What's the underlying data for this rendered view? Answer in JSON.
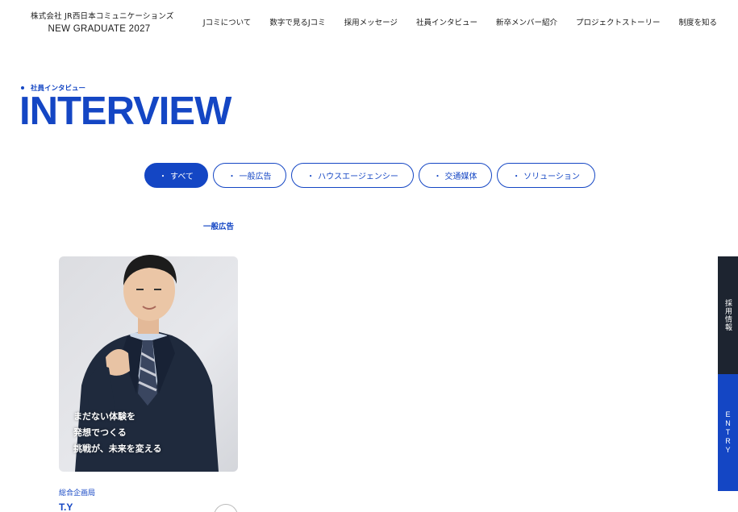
{
  "header": {
    "company": "株式会社 JR西日本コミュニケーションズ",
    "subtitle": "NEW GRADUATE 2027",
    "nav": [
      "Jコミについて",
      "数字で見るJコミ",
      "採用メッセージ",
      "社員インタビュー",
      "新卒メンバー紹介",
      "プロジェクトストーリー",
      "制度を知る"
    ]
  },
  "heading": {
    "eyebrow": "社員インタビュー",
    "title": "INTERVIEW"
  },
  "filters": {
    "bullet": "・",
    "items": [
      "すべて",
      "一般広告",
      "ハウスエージェンシー",
      "交通媒体",
      "ソリューション"
    ],
    "active_index": 0
  },
  "card": {
    "category": "一般広告",
    "caption": [
      "まだない体験を",
      "発想でつくる",
      "挑戦が、未来を変える"
    ],
    "department": "総合企画局",
    "name": "T.Y"
  },
  "side": {
    "recruit": "採用情報",
    "entry": "ENTRY"
  },
  "colors": {
    "accent": "#1446c4",
    "side_dark": "#1d2430"
  }
}
